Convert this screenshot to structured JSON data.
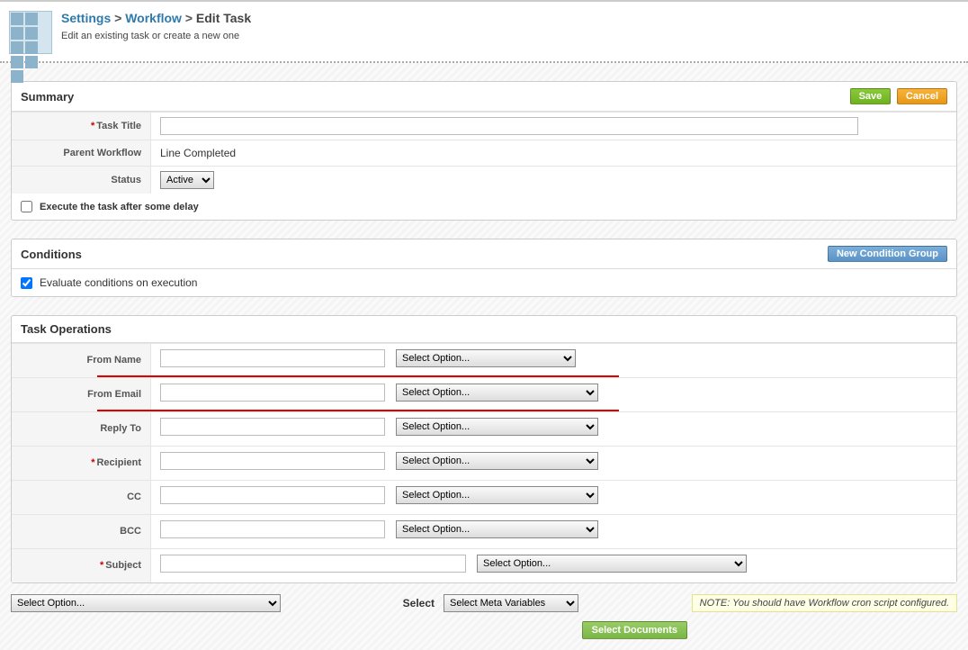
{
  "breadcrumb": {
    "settings": "Settings",
    "workflow": "Workflow",
    "current": "Edit Task",
    "sep": ">"
  },
  "subtitle": "Edit an existing task or create a new one",
  "summary": {
    "title": "Summary",
    "save": "Save",
    "cancel": "Cancel",
    "task_title_label": "Task Title",
    "parent_workflow_label": "Parent Workflow",
    "parent_workflow_value": "Line Completed",
    "status_label": "Status",
    "status_value": "Active",
    "delay_label": "Execute the task after some delay"
  },
  "conditions": {
    "title": "Conditions",
    "new_group": "New Condition Group",
    "evaluate_label": "Evaluate conditions on execution"
  },
  "ops": {
    "title": "Task Operations",
    "from_name": "From Name",
    "from_email": "From Email",
    "reply_to": "Reply To",
    "recipient": "Recipient",
    "cc": "CC",
    "bcc": "BCC",
    "subject": "Subject",
    "select_option": "Select Option...",
    "select_label": "Select",
    "meta_vars": "Select Meta Variables",
    "note": "NOTE: You should have Workflow cron script configured.",
    "select_documents": "Select Documents"
  }
}
